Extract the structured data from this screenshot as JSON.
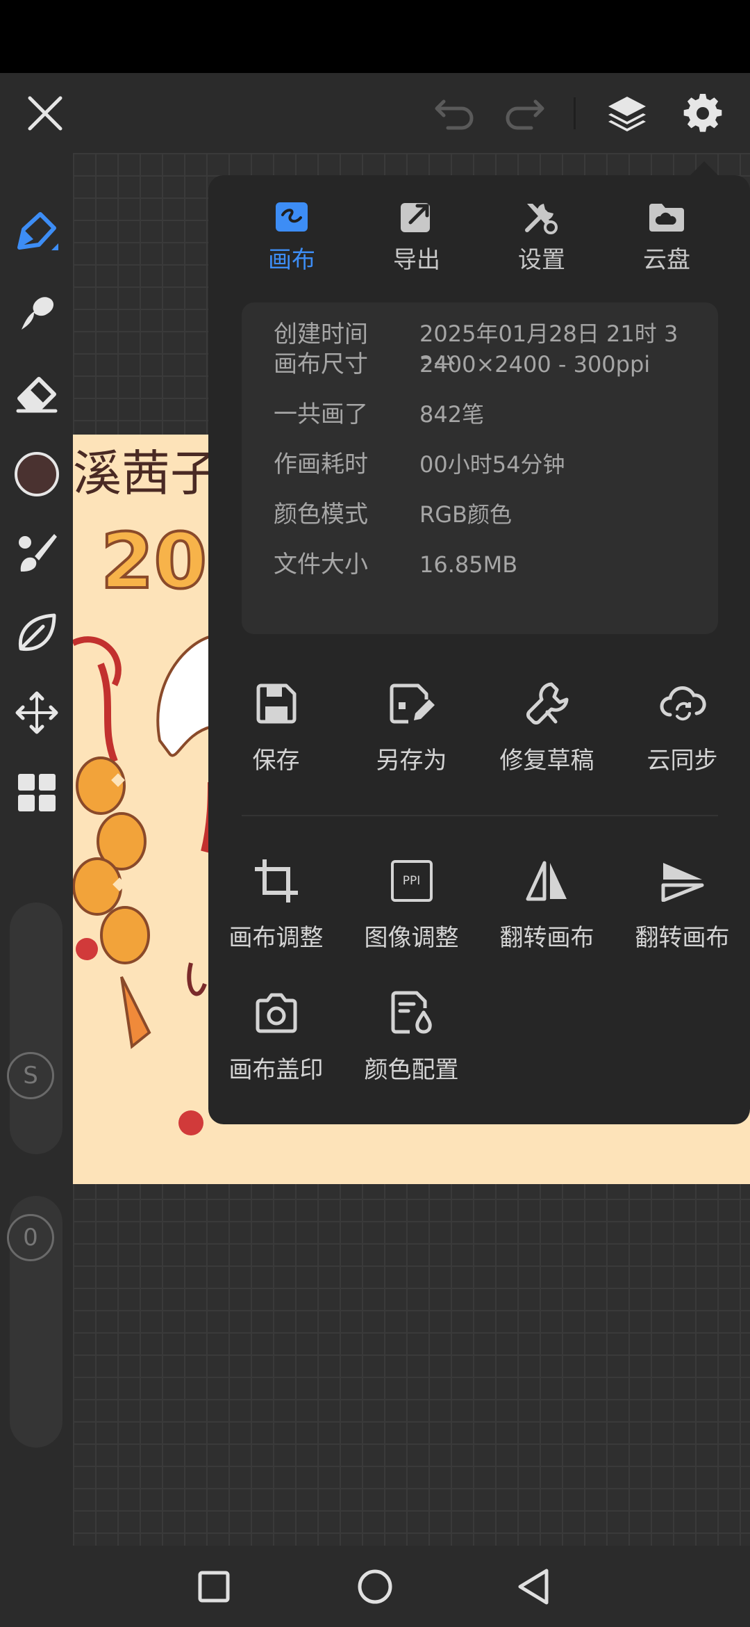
{
  "toolbar": {
    "close_icon": "close-icon",
    "undo_icon": "undo-icon",
    "redo_icon": "redo-icon",
    "layers_icon": "layers-icon",
    "settings_icon": "gear-icon"
  },
  "tools": {
    "current_color": "#4a3230",
    "accent": "#3d8df5",
    "size_slider_label": "S",
    "opacity_slider_label": "0"
  },
  "popup": {
    "tabs": [
      {
        "label": "画布",
        "icon": "canvas-icon",
        "active": true
      },
      {
        "label": "导出",
        "icon": "export-icon",
        "active": false
      },
      {
        "label": "设置",
        "icon": "settings-tools-icon",
        "active": false
      },
      {
        "label": "云盘",
        "icon": "cloud-folder-icon",
        "active": false
      }
    ],
    "info": [
      {
        "label": "创建时间",
        "value": "2025年01月28日 21时 33分"
      },
      {
        "label": "画布尺寸",
        "value": "2400×2400 - 300ppi"
      },
      {
        "label": "一共画了",
        "value": "842笔"
      },
      {
        "label": "作画耗时",
        "value": "00小时54分钟"
      },
      {
        "label": "颜色模式",
        "value": "RGB颜色"
      },
      {
        "label": "文件大小",
        "value": "16.85MB"
      }
    ],
    "actions": [
      {
        "label": "保存",
        "icon": "save-icon"
      },
      {
        "label": "另存为",
        "icon": "save-as-icon"
      },
      {
        "label": "修复草稿",
        "icon": "wrench-icon"
      },
      {
        "label": "云同步",
        "icon": "cloud-sync-icon"
      },
      {
        "label": "画布调整",
        "icon": "crop-icon"
      },
      {
        "label": "图像调整",
        "icon": "ppi-icon",
        "icon_text": "PPI"
      },
      {
        "label": "翻转画布",
        "icon": "flip-horizontal-icon"
      },
      {
        "label": "翻转画布",
        "icon": "flip-vertical-icon"
      },
      {
        "label": "画布盖印",
        "icon": "camera-icon"
      },
      {
        "label": "颜色配置",
        "icon": "color-profile-icon"
      }
    ]
  }
}
